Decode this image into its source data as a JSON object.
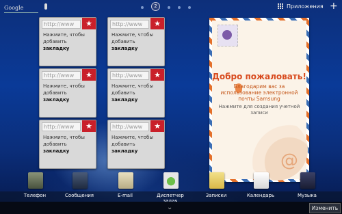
{
  "top": {
    "search_label": "Google",
    "page_indicator": "2",
    "apps_label": "Приложения",
    "add_label": "+"
  },
  "bookmarks": [
    {
      "url": "http://www",
      "line1": "Нажмите, чтобы",
      "line2": "добавить",
      "line3": "закладку"
    },
    {
      "url": "http://www",
      "line1": "Нажмите, чтобы",
      "line2": "добавить",
      "line3": "закладку"
    },
    {
      "url": "http://www",
      "line1": "Нажмите, чтобы",
      "line2": "добавить",
      "line3": "закладку"
    },
    {
      "url": "http://www",
      "line1": "Нажмите, чтобы",
      "line2": "добавить",
      "line3": "закладку"
    },
    {
      "url": "http://www",
      "line1": "Нажмите, чтобы",
      "line2": "добавить",
      "line3": "закладку"
    },
    {
      "url": "http://www",
      "line1": "Нажмите, чтобы",
      "line2": "добавить",
      "line3": "закладку"
    }
  ],
  "welcome": {
    "title": "Добро пожаловать!",
    "line1": "Благодарим вас за",
    "line2": "использование электронной",
    "line3": "почты Samsung",
    "hint1": "Нажмите для создания учетной",
    "hint2": "записи"
  },
  "dock": [
    {
      "label": "Телефон",
      "color": "#5f6a55"
    },
    {
      "label": "Сообщения",
      "color": "#2c3b52"
    },
    {
      "label": "E-mail",
      "color": "#cfc7a5"
    },
    {
      "label": "Диспетчер задач",
      "color": "#e6e6e6"
    },
    {
      "label": "Записки",
      "color": "#e8cf6a"
    },
    {
      "label": "Календарь",
      "color": "#f2f2f2"
    },
    {
      "label": "Музыка",
      "color": "#2a2e48"
    }
  ],
  "bottom": {
    "edit_label": "Изменить"
  }
}
